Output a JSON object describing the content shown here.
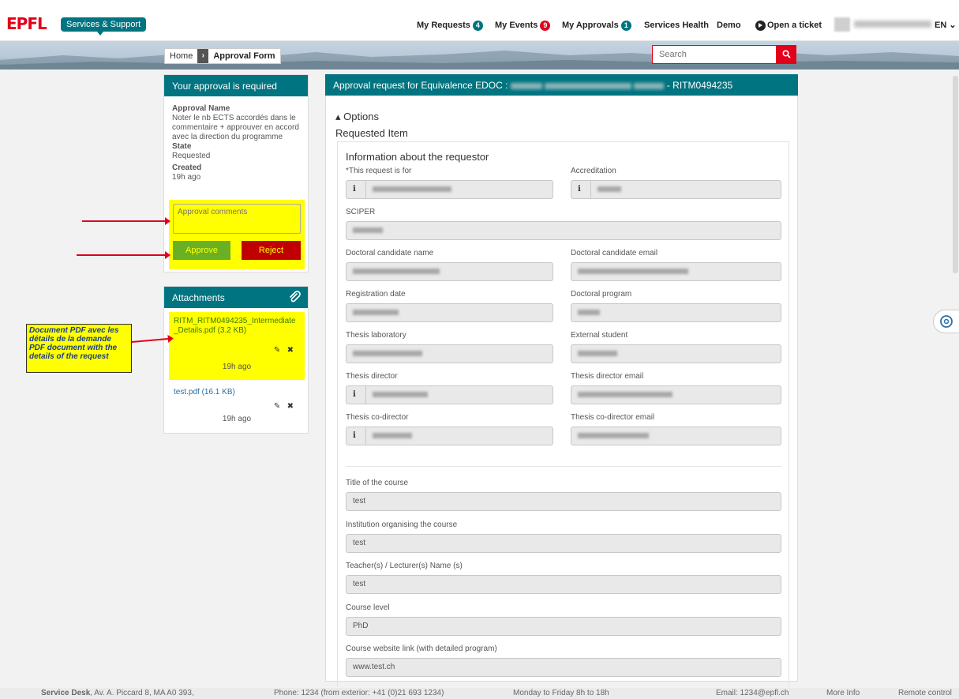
{
  "brand": {
    "logo": "EPFL",
    "app_name": "Services & Support"
  },
  "topnav": {
    "items": [
      {
        "label": "My Requests",
        "badge": "4"
      },
      {
        "label": "My Events",
        "badge": "9"
      },
      {
        "label": "My Approvals",
        "badge": "1"
      },
      {
        "label": "Services Health"
      },
      {
        "label": "Demo"
      },
      {
        "label": "Open a ticket"
      }
    ],
    "language": "EN"
  },
  "breadcrumb": {
    "home": "Home",
    "current": "Approval Form"
  },
  "search": {
    "placeholder": "Search"
  },
  "approval_card": {
    "title": "Your approval is required",
    "approval_name_label": "Approval Name",
    "approval_name_value": "Noter le nb ECTS accordés dans le commentaire + approuver en accord avec la direction du programme",
    "state_label": "State",
    "state_value": "Requested",
    "created_label": "Created",
    "created_value": "19h ago",
    "comments_placeholder": "Approval comments",
    "approve_label": "Approve",
    "reject_label": "Reject"
  },
  "attachments": {
    "title": "Attachments",
    "items": [
      {
        "name": "RITM_RITM0494235_Intermediate_Details.pdf (3.2 KB)",
        "time": "19h ago"
      },
      {
        "name": "test.pdf (16.1 KB)",
        "time": "19h ago"
      }
    ]
  },
  "annotation": {
    "text": "Document PDF avec les détails de la demande PDF document with the details of the request"
  },
  "main": {
    "header_prefix": "Approval request for Equivalence EDOC :",
    "header_suffix": "- RITM0494235",
    "options_label": "Options",
    "requested_item_label": "Requested Item",
    "section_title": "Information about the requestor",
    "required_mark": "*",
    "fields": {
      "request_for": "This request is for",
      "accreditation": "Accreditation",
      "sciper": "SCIPER",
      "candidate_name": "Doctoral candidate name",
      "candidate_email": "Doctoral candidate email",
      "registration_date": "Registration date",
      "doctoral_program": "Doctoral program",
      "thesis_lab": "Thesis laboratory",
      "external_student": "External student",
      "thesis_director": "Thesis director",
      "thesis_director_email": "Thesis director email",
      "thesis_codirector": "Thesis co-director",
      "thesis_codirector_email": "Thesis co-director email",
      "course_title": "Title of the course",
      "course_title_value": "test",
      "institution": "Institution organising the course",
      "institution_value": "test",
      "teachers": "Teacher(s) / Lecturer(s) Name (s)",
      "teachers_value": "test",
      "course_level": "Course level",
      "course_level_value": "PhD",
      "course_link": "Course website link (with detailed program)",
      "course_link_value": "www.test.ch"
    }
  },
  "footer": {
    "service_desk_label": "Service Desk",
    "address": ", Av. A. Piccard 8, MA A0 393,",
    "phone": "Phone: 1234 (from exterior: +41 (0)21 693 1234)",
    "hours": "Monday to Friday 8h to 18h",
    "email": "Email: 1234@epfl.ch",
    "more_info": "More Info",
    "remote_control": "Remote control"
  },
  "colors": {
    "teal": "#007480",
    "epfl_red": "#e2001a",
    "highlight": "#ffff00",
    "approve": "#6ab023",
    "reject": "#c00000"
  }
}
